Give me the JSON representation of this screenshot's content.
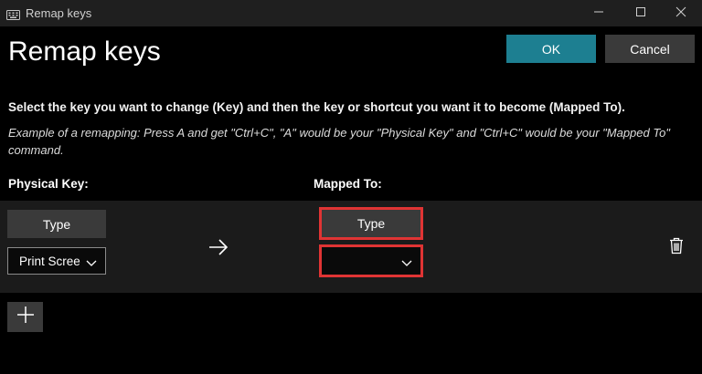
{
  "window": {
    "title": "Remap keys"
  },
  "header": {
    "heading": "Remap keys",
    "ok_label": "OK",
    "cancel_label": "Cancel"
  },
  "instructions": {
    "main": "Select the key you want to change (Key) and then the key or shortcut you want it to become (Mapped To).",
    "example": "Example of a remapping: Press A and get \"Ctrl+C\", \"A\" would be your \"Physical Key\" and \"Ctrl+C\" would be your \"Mapped To\" command."
  },
  "columns": {
    "physical": "Physical Key:",
    "mapped": "Mapped To:"
  },
  "mapping": {
    "physical_type_label": "Type",
    "physical_selected": "Print Scree",
    "mapped_type_label": "Type",
    "mapped_selected": ""
  },
  "colors": {
    "accent": "#1d7f91",
    "highlight": "#e03434",
    "button": "#3a3a3a",
    "row_bg": "#1b1b1b"
  },
  "icons": [
    "keyboard-icon",
    "minimize-icon",
    "maximize-icon",
    "close-icon",
    "chevron-down-icon",
    "arrow-right-icon",
    "trash-icon",
    "plus-icon"
  ]
}
